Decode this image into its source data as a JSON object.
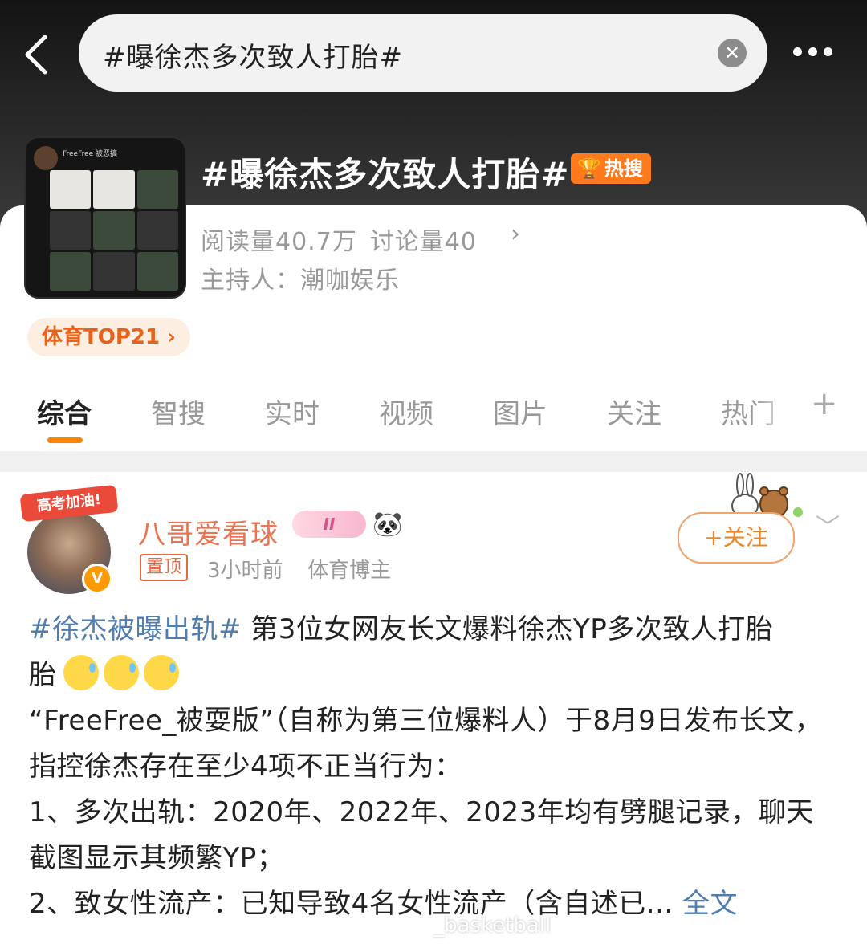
{
  "search": {
    "query": "#曝徐杰多次致人打胎#",
    "clear_icon": "close-icon"
  },
  "topic": {
    "title": "#曝徐杰多次致人打胎#",
    "hot_badge": "热搜",
    "stats": {
      "read_label": "阅读量",
      "read_value": "40.7万",
      "discuss_label": "讨论量",
      "discuss_value": "40"
    },
    "host": "主持人：潮咖娱乐",
    "rank": "体育TOP21 ›",
    "thumbnail": {
      "name": "FreeFree 被恶搞"
    }
  },
  "tabs": [
    {
      "label": "综合",
      "active": true
    },
    {
      "label": "智搜"
    },
    {
      "label": "实时"
    },
    {
      "label": "视频"
    },
    {
      "label": "图片"
    },
    {
      "label": "关注"
    },
    {
      "label": "热门"
    }
  ],
  "post": {
    "avatar_banner": "高考加油!",
    "username": "八哥爱看球",
    "level": "II",
    "pin": "置顶",
    "time": "3小时前",
    "role": "体育博主",
    "follow": "+关注",
    "hashtag": "#徐杰被曝出轨#",
    "line1": " 第3位女网友长文爆料徐杰YP多次致人打胎",
    "para2": "“FreeFree_被耍版”（自称为第三位爆料人）于8月9日发布长文，指控徐杰存在至少4项不正当行为：",
    "para3": "1、多次出轨：2020年、2022年、2023年均有劈腿记录，聊天截图显示其频繁YP；",
    "para4": "2、致女性流产：已知导致4名女性流产（含自述已...",
    "more_link": "全文"
  },
  "watermark": "_basketball",
  "colors": {
    "accent": "#ff8200",
    "username": "#eb7350",
    "link": "#507daf",
    "hot": "#ff7a1a"
  }
}
